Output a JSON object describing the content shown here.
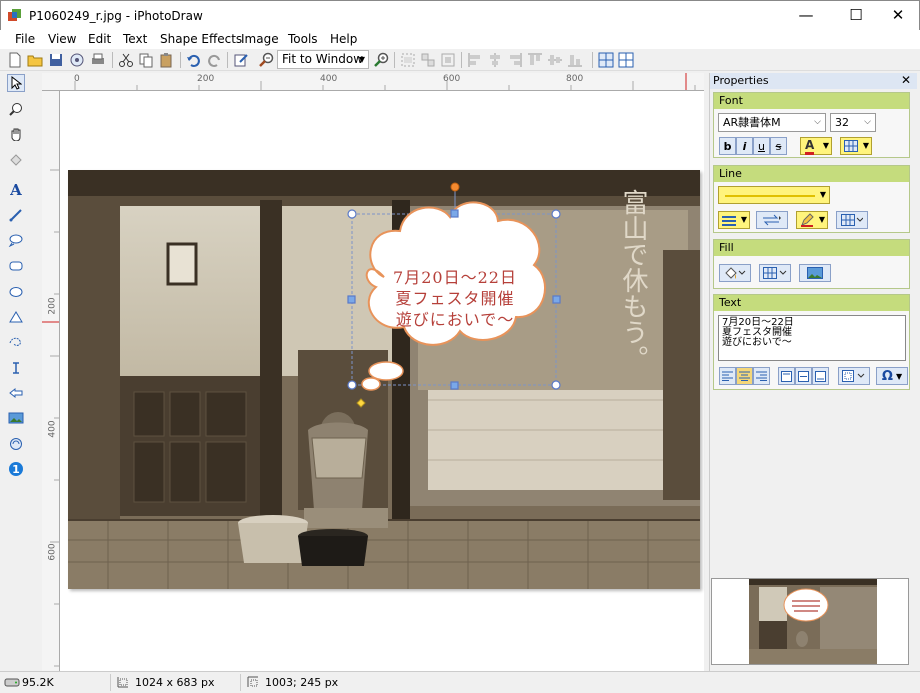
{
  "window": {
    "title": "P1060249_r.jpg - iPhotoDraw",
    "minimize": "—",
    "maximize": "☐",
    "close": "✕"
  },
  "menu": [
    "File",
    "View",
    "Edit",
    "Text",
    "Shape Effects",
    "Image",
    "Tools",
    "Help"
  ],
  "toolbar": {
    "zoom": "Fit to Window"
  },
  "ruler": {
    "unit": "px",
    "h_labels": [
      "0",
      "200",
      "400",
      "600",
      "800"
    ],
    "v_labels": [
      "200",
      "400",
      "600"
    ]
  },
  "callout": {
    "lines": [
      "7月20日～22日",
      "夏フェスタ開催",
      "遊びにおいで～"
    ],
    "text_color": "#b6403a",
    "border_color": "#e8935a"
  },
  "properties": {
    "title": "Properties",
    "font_group": "Font",
    "font_name": "AR隷書体M",
    "font_size": "32",
    "bold": "b",
    "italic": "i",
    "underline": "u",
    "strike": "s",
    "font_color_glyph": "A",
    "line_group": "Line",
    "fill_group": "Fill",
    "text_group": "Text",
    "text_content": "7月20日～22日\n夏フェスタ開催\n遊びにおいで～",
    "special_char": "Ω",
    "accent_color": "#c5dc7d"
  },
  "status": {
    "file_size": "95.2K",
    "image_size": "1024 x 683 px",
    "cursor": "1003; 245 px"
  }
}
